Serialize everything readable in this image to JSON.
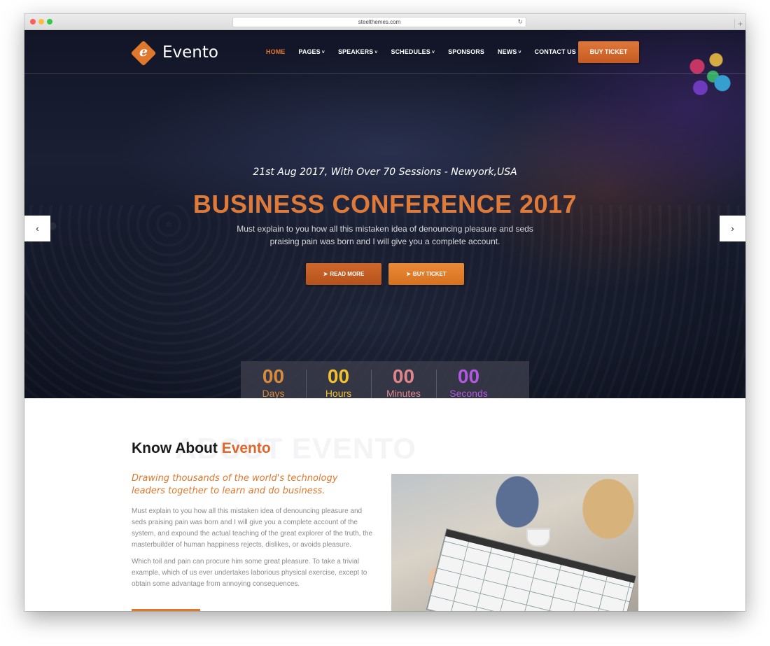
{
  "browser": {
    "url": "steelthemes.com"
  },
  "nav": {
    "brand": "Evento",
    "logo_letter": "e",
    "items": [
      {
        "label": "HOME",
        "active": true,
        "dropdown": false
      },
      {
        "label": "PAGES",
        "active": false,
        "dropdown": true
      },
      {
        "label": "SPEAKERS",
        "active": false,
        "dropdown": true
      },
      {
        "label": "SCHEDULES",
        "active": false,
        "dropdown": true
      },
      {
        "label": "SPONSORS",
        "active": false,
        "dropdown": false
      },
      {
        "label": "NEWS",
        "active": false,
        "dropdown": true
      },
      {
        "label": "CONTACT US",
        "active": false,
        "dropdown": false
      }
    ],
    "ticket_label": "BUY TICKET"
  },
  "hero": {
    "subtitle": "21st Aug 2017, With Over 70 Sessions - Newyork,USA",
    "title": "BUSINESS CONFERENCE 2017",
    "description": "Must explain to you how all this mistaken idea of denouncing pleasure and seds praising pain was born and I will give you a complete account.",
    "read_more_label": "READ MORE",
    "buy_ticket_label": "BUY TICKET",
    "prev_arrow": "‹",
    "next_arrow": "›"
  },
  "countdown": [
    {
      "value": "00",
      "label": "Days",
      "color": "#d98a3a"
    },
    {
      "value": "00",
      "label": "Hours",
      "color": "#f2c12e"
    },
    {
      "value": "00",
      "label": "Minutes",
      "color": "#e0868a"
    },
    {
      "value": "00",
      "label": "Seconds",
      "color": "#b358e0"
    }
  ],
  "about": {
    "ghost_text": "ABOUT EVENTO",
    "heading_prefix": "Know About ",
    "heading_accent": "Evento",
    "lead": "Drawing thousands of the world's technology leaders together to learn and do business.",
    "paragraph1": "Must explain to you how all this mistaken idea of denouncing pleasure and seds praising pain was born and I will give you a complete account of the system, and expound the actual teaching of the great explorer of the truth, the masterbuilder of human happiness rejects, dislikes, or avoids pleasure.",
    "paragraph2": "Which toil and pain can procure him some great pleasure. To take a trivial example, which of us ever undertakes laborious physical exercise, except to obtain some advantage from annoying consequences."
  },
  "colors": {
    "accent": "#e0772c",
    "hero_bg": "#141929"
  }
}
